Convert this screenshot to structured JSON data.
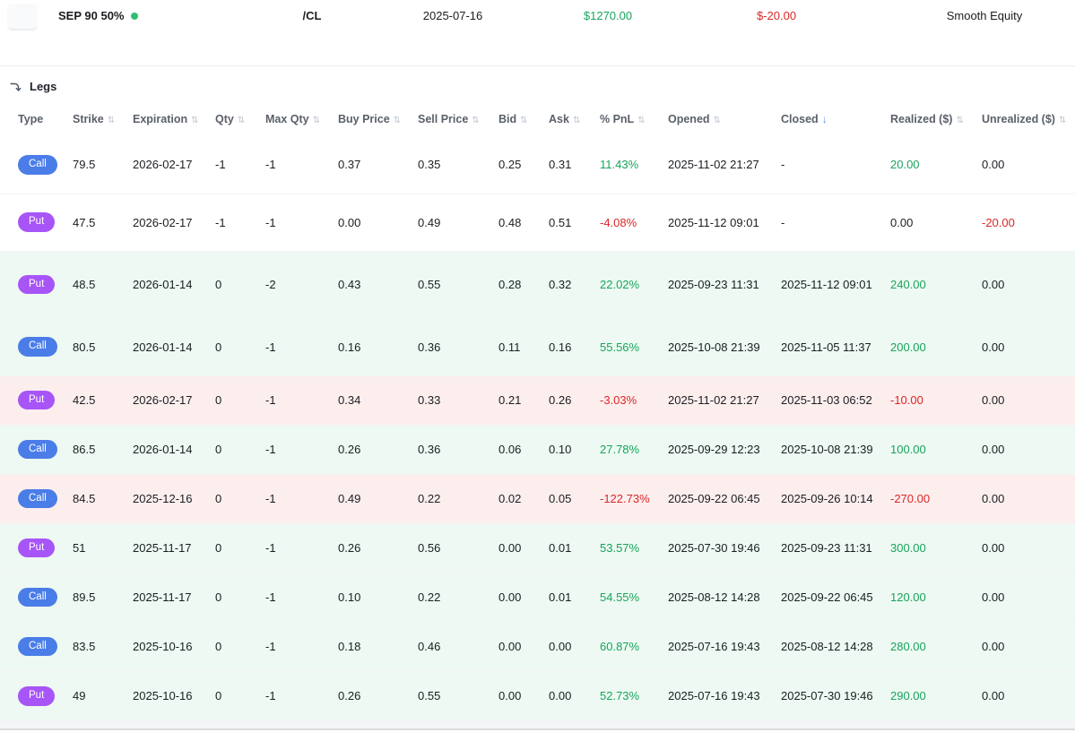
{
  "topbar": {
    "strategy_name": "SEP 90 50%",
    "status_dot_color": "#2fbf71",
    "symbol": "/CL",
    "start_date": "2025-07-16",
    "realized_total": "$1270.00",
    "unrealized_total": "$-20.00",
    "mode_label": "Smooth Equity"
  },
  "colors": {
    "green": "#18a45c",
    "red": "#dc2626",
    "call_badge": "#4a7de8",
    "put_badge": "#a855f7",
    "row_green_bg": "#edf9f2",
    "row_red_bg": "#fdeeee",
    "active_sort": "#5c8df6"
  },
  "legs": {
    "title": "Legs",
    "columns": [
      {
        "label": "Type",
        "sortable": false,
        "sort": "none"
      },
      {
        "label": "Strike",
        "sortable": true,
        "sort": "none"
      },
      {
        "label": "Expiration",
        "sortable": true,
        "sort": "none"
      },
      {
        "label": "Qty",
        "sortable": true,
        "sort": "none"
      },
      {
        "label": "Max Qty",
        "sortable": true,
        "sort": "none"
      },
      {
        "label": "Buy Price",
        "sortable": true,
        "sort": "none"
      },
      {
        "label": "Sell Price",
        "sortable": true,
        "sort": "none"
      },
      {
        "label": "Bid",
        "sortable": true,
        "sort": "none"
      },
      {
        "label": "Ask",
        "sortable": true,
        "sort": "none"
      },
      {
        "label": "% PnL",
        "sortable": true,
        "sort": "none"
      },
      {
        "label": "Opened",
        "sortable": true,
        "sort": "none"
      },
      {
        "label": "Closed",
        "sortable": true,
        "sort": "desc"
      },
      {
        "label": "Realized ($)",
        "sortable": true,
        "sort": "none"
      },
      {
        "label": "Unrealized ($)",
        "sortable": true,
        "sort": "none"
      }
    ],
    "rows": [
      {
        "type": "Call",
        "strike": "79.5",
        "expiration": "2026-02-17",
        "qty": "-1",
        "max_qty": "-1",
        "buy_price": "0.37",
        "sell_price": "0.35",
        "bid": "0.25",
        "ask": "0.31",
        "pnl_pct": "11.43%",
        "pnl_pct_color": "green",
        "opened": "2025-11-02 21:27",
        "closed": "-",
        "realized": "20.00",
        "realized_color": "green",
        "unrealized": "0.00",
        "unrealized_color": "default",
        "bg": "white"
      },
      {
        "type": "Put",
        "strike": "47.5",
        "expiration": "2026-02-17",
        "qty": "-1",
        "max_qty": "-1",
        "buy_price": "0.00",
        "sell_price": "0.49",
        "bid": "0.48",
        "ask": "0.51",
        "pnl_pct": "-4.08%",
        "pnl_pct_color": "red",
        "opened": "2025-11-12 09:01",
        "closed": "-",
        "realized": "0.00",
        "realized_color": "default",
        "unrealized": "-20.00",
        "unrealized_color": "red",
        "bg": "white"
      },
      {
        "type": "Put",
        "strike": "48.5",
        "expiration": "2026-01-14",
        "qty": "0",
        "max_qty": "-2",
        "buy_price": "0.43",
        "sell_price": "0.55",
        "bid": "0.28",
        "ask": "0.32",
        "pnl_pct": "22.02%",
        "pnl_pct_color": "green",
        "opened": "2025-09-23 11:31",
        "closed": "2025-11-12 09:01",
        "realized": "240.00",
        "realized_color": "green",
        "unrealized": "0.00",
        "unrealized_color": "default",
        "bg": "green"
      },
      {
        "type": "Call",
        "strike": "80.5",
        "expiration": "2026-01-14",
        "qty": "0",
        "max_qty": "-1",
        "buy_price": "0.16",
        "sell_price": "0.36",
        "bid": "0.11",
        "ask": "0.16",
        "pnl_pct": "55.56%",
        "pnl_pct_color": "green",
        "opened": "2025-10-08 21:39",
        "closed": "2025-11-05 11:37",
        "realized": "200.00",
        "realized_color": "green",
        "unrealized": "0.00",
        "unrealized_color": "default",
        "bg": "green"
      },
      {
        "type": "Put",
        "strike": "42.5",
        "expiration": "2026-02-17",
        "qty": "0",
        "max_qty": "-1",
        "buy_price": "0.34",
        "sell_price": "0.33",
        "bid": "0.21",
        "ask": "0.26",
        "pnl_pct": "-3.03%",
        "pnl_pct_color": "red",
        "opened": "2025-11-02 21:27",
        "closed": "2025-11-03 06:52",
        "realized": "-10.00",
        "realized_color": "red",
        "unrealized": "0.00",
        "unrealized_color": "default",
        "bg": "red"
      },
      {
        "type": "Call",
        "strike": "86.5",
        "expiration": "2026-01-14",
        "qty": "0",
        "max_qty": "-1",
        "buy_price": "0.26",
        "sell_price": "0.36",
        "bid": "0.06",
        "ask": "0.10",
        "pnl_pct": "27.78%",
        "pnl_pct_color": "green",
        "opened": "2025-09-29 12:23",
        "closed": "2025-10-08 21:39",
        "realized": "100.00",
        "realized_color": "green",
        "unrealized": "0.00",
        "unrealized_color": "default",
        "bg": "green"
      },
      {
        "type": "Call",
        "strike": "84.5",
        "expiration": "2025-12-16",
        "qty": "0",
        "max_qty": "-1",
        "buy_price": "0.49",
        "sell_price": "0.22",
        "bid": "0.02",
        "ask": "0.05",
        "pnl_pct": "-122.73%",
        "pnl_pct_color": "red",
        "opened": "2025-09-22 06:45",
        "closed": "2025-09-26 10:14",
        "realized": "-270.00",
        "realized_color": "red",
        "unrealized": "0.00",
        "unrealized_color": "default",
        "bg": "red"
      },
      {
        "type": "Put",
        "strike": "51",
        "expiration": "2025-11-17",
        "qty": "0",
        "max_qty": "-1",
        "buy_price": "0.26",
        "sell_price": "0.56",
        "bid": "0.00",
        "ask": "0.01",
        "pnl_pct": "53.57%",
        "pnl_pct_color": "green",
        "opened": "2025-07-30 19:46",
        "closed": "2025-09-23 11:31",
        "realized": "300.00",
        "realized_color": "green",
        "unrealized": "0.00",
        "unrealized_color": "default",
        "bg": "green"
      },
      {
        "type": "Call",
        "strike": "89.5",
        "expiration": "2025-11-17",
        "qty": "0",
        "max_qty": "-1",
        "buy_price": "0.10",
        "sell_price": "0.22",
        "bid": "0.00",
        "ask": "0.01",
        "pnl_pct": "54.55%",
        "pnl_pct_color": "green",
        "opened": "2025-08-12 14:28",
        "closed": "2025-09-22 06:45",
        "realized": "120.00",
        "realized_color": "green",
        "unrealized": "0.00",
        "unrealized_color": "default",
        "bg": "green"
      },
      {
        "type": "Call",
        "strike": "83.5",
        "expiration": "2025-10-16",
        "qty": "0",
        "max_qty": "-1",
        "buy_price": "0.18",
        "sell_price": "0.46",
        "bid": "0.00",
        "ask": "0.00",
        "pnl_pct": "60.87%",
        "pnl_pct_color": "green",
        "opened": "2025-07-16 19:43",
        "closed": "2025-08-12 14:28",
        "realized": "280.00",
        "realized_color": "green",
        "unrealized": "0.00",
        "unrealized_color": "default",
        "bg": "green"
      },
      {
        "type": "Put",
        "strike": "49",
        "expiration": "2025-10-16",
        "qty": "0",
        "max_qty": "-1",
        "buy_price": "0.26",
        "sell_price": "0.55",
        "bid": "0.00",
        "ask": "0.00",
        "pnl_pct": "52.73%",
        "pnl_pct_color": "green",
        "opened": "2025-07-16 19:43",
        "closed": "2025-07-30 19:46",
        "realized": "290.00",
        "realized_color": "green",
        "unrealized": "0.00",
        "unrealized_color": "default",
        "bg": "green"
      }
    ],
    "sort_icon_inactive": "⇅",
    "sort_icon_desc": "↓"
  }
}
